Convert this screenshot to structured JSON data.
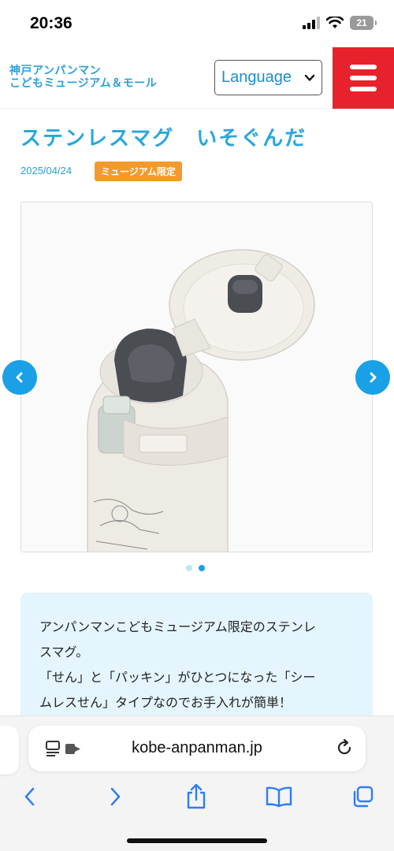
{
  "status_bar": {
    "time": "20:36",
    "battery": "21",
    "icons": [
      "signal-icon",
      "wifi-icon",
      "battery-icon"
    ]
  },
  "header": {
    "logo_line1": "神戸アンパンマン",
    "logo_line2": "こどもミュージアム＆モール",
    "language_label": "Language",
    "menu_icon": "hamburger-menu-icon",
    "accent_color": "#e8222c",
    "brand_color": "#2aa0d8"
  },
  "article": {
    "title": "ステンレスマグ　いそぐんだ",
    "date": "2025/04/24",
    "badge": "ミュージアム限定",
    "badge_color": "#f49a2c",
    "carousel": {
      "image_subject": "stainless-mug-open-lid",
      "slide_count": 2,
      "active_slide": 2,
      "prev_icon": "chevron-left-icon",
      "next_icon": "chevron-right-icon"
    },
    "description_lines": [
      "アンパンマンこどもミュージアム限定のステンレ",
      "スマグ。",
      "「せん」と「パッキン」がひとつになった「シー",
      "ムレスせん」タイプなのでお手入れが簡単！"
    ]
  },
  "browser": {
    "url": "kobe-anpanman.jp",
    "toolbar_icons": [
      "back-icon",
      "forward-icon",
      "share-icon",
      "bookmarks-icon",
      "tabs-icon"
    ]
  }
}
